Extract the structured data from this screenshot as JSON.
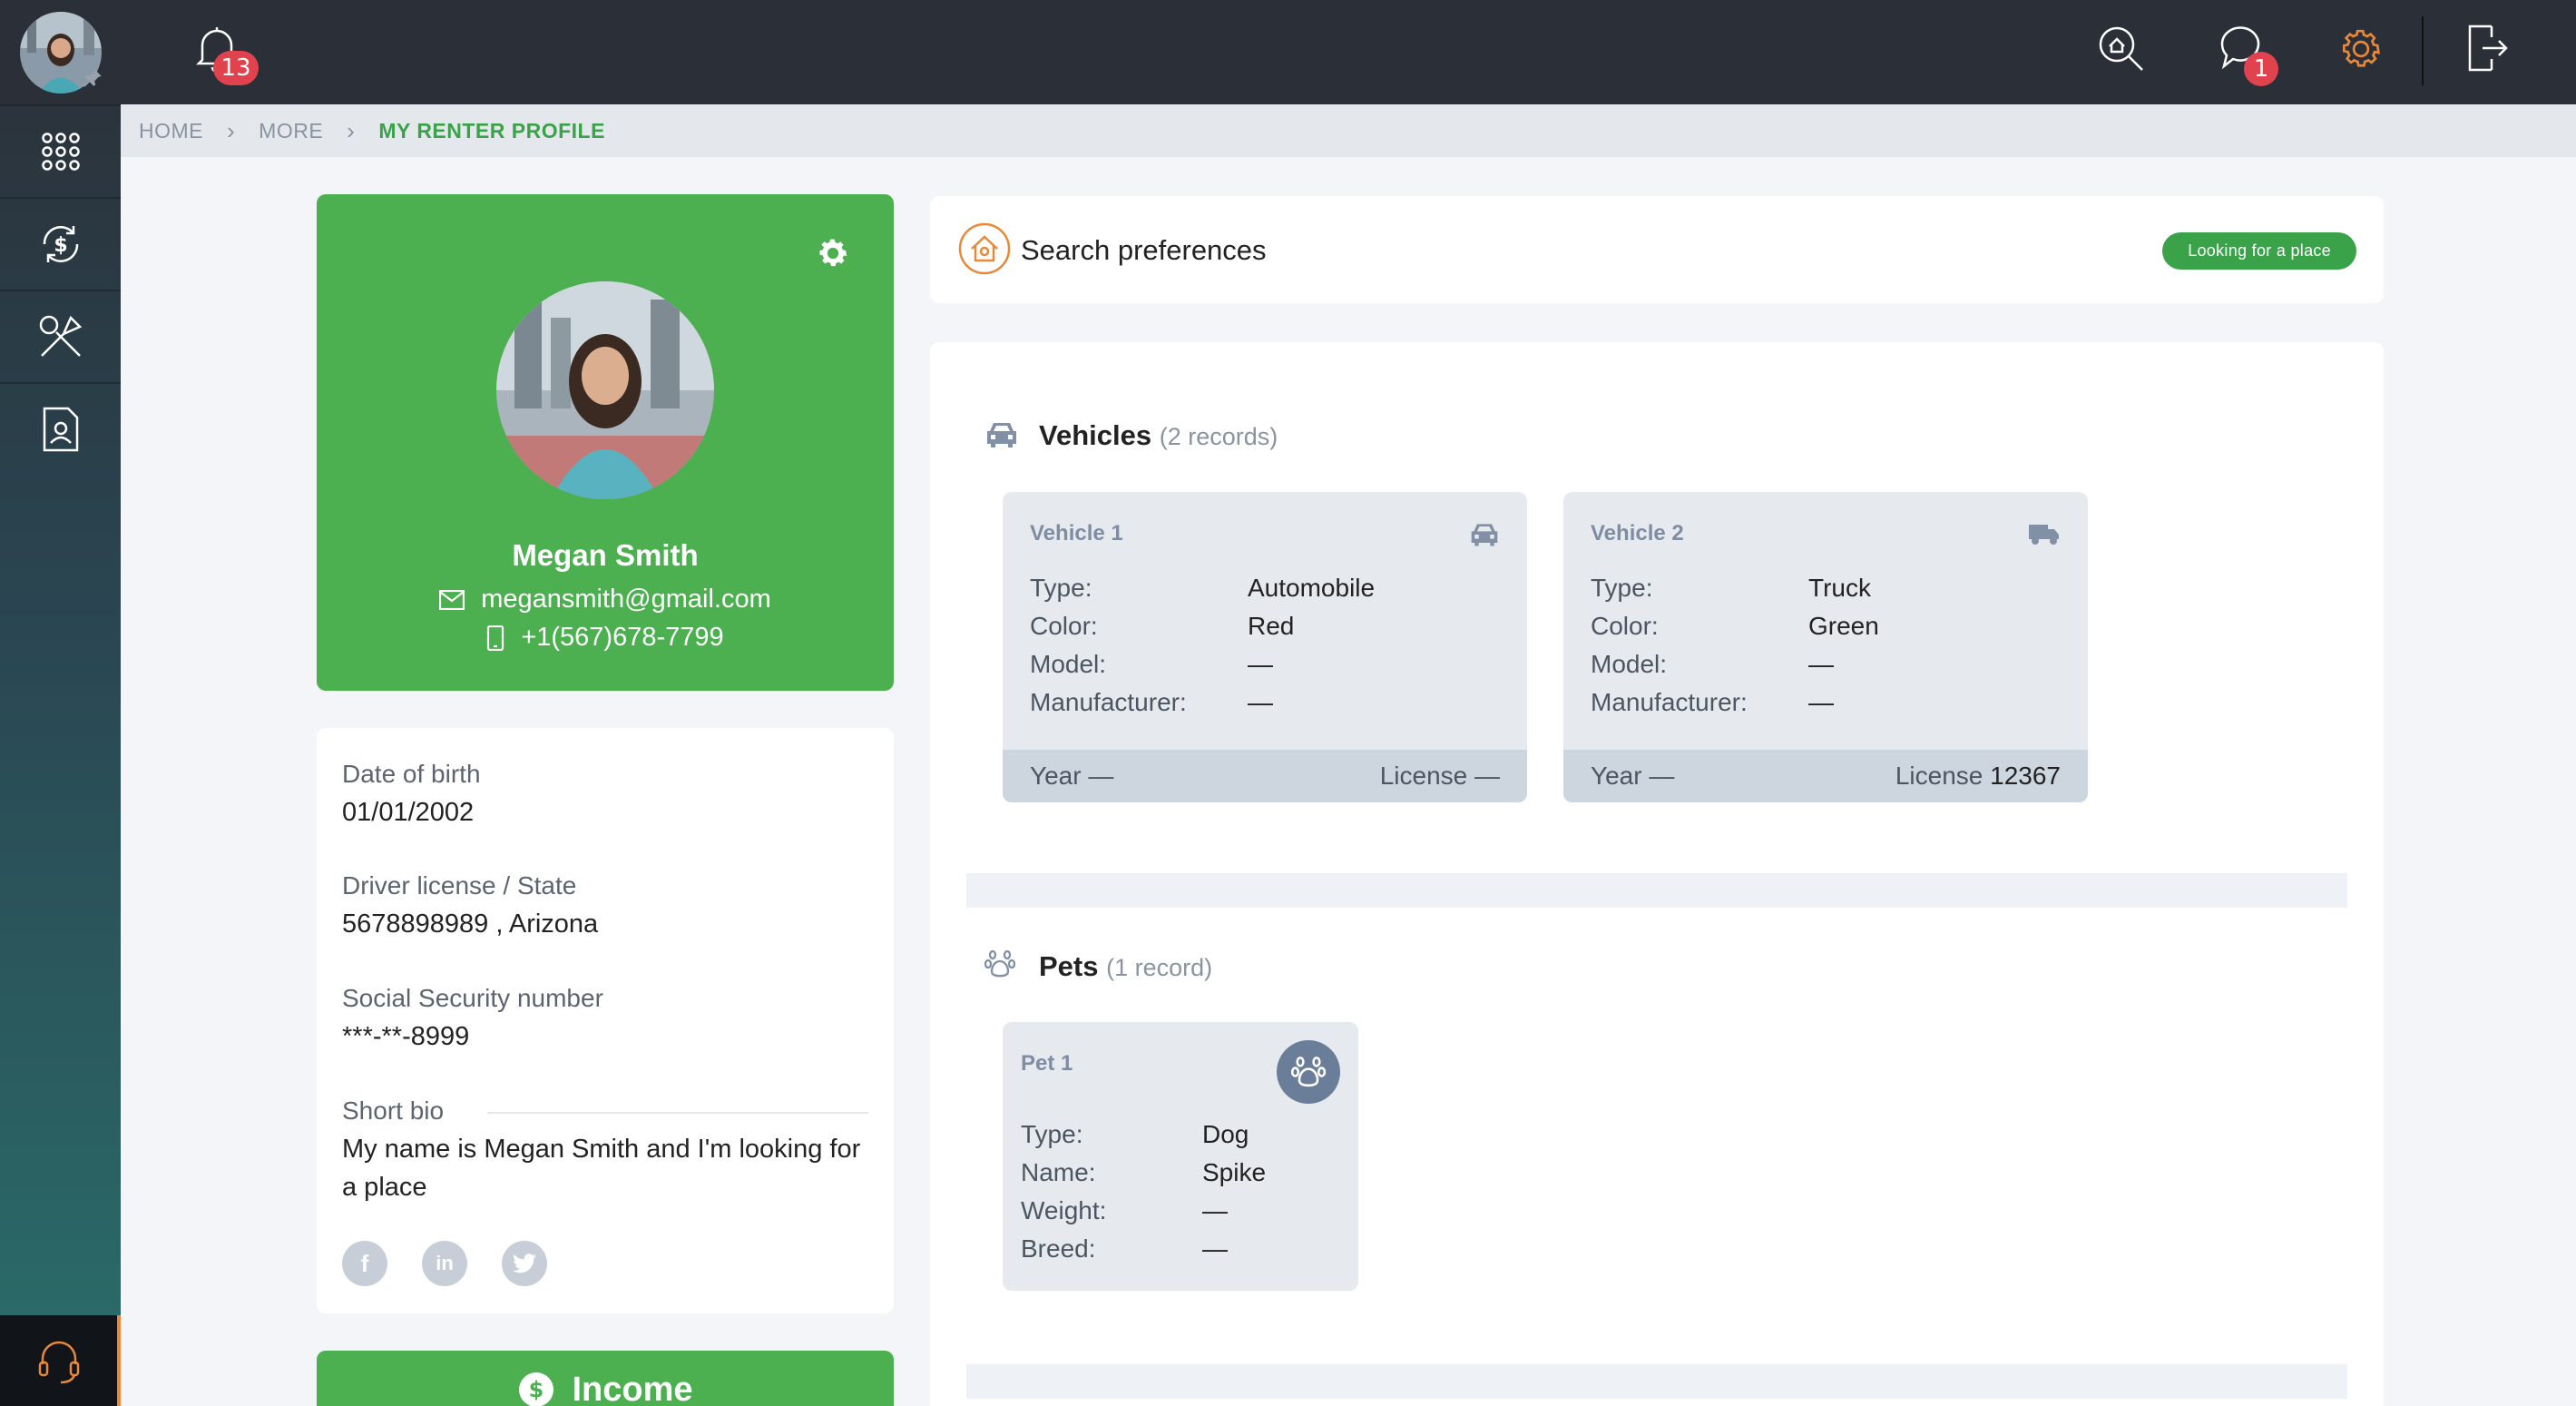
{
  "topbar": {
    "notification_count": "13",
    "message_count": "1"
  },
  "breadcrumb": [
    "HOME",
    "MORE",
    "MY RENTER PROFILE"
  ],
  "profile": {
    "name": "Megan Smith",
    "email": "megansmith@gmail.com",
    "phone": "+1(567)678-7799"
  },
  "details": {
    "dob_label": "Date of birth",
    "dob": "01/01/2002",
    "license_label": "Driver license / State",
    "license": "5678898989 , Arizona",
    "ssn_label": "Social Security number",
    "ssn": "***-**-8999",
    "bio_label": "Short bio",
    "bio_1": "My name is Megan Smith and I'm looking for",
    "bio_2": "a place"
  },
  "income": {
    "label": "Income"
  },
  "prefs": {
    "title": "Search preferences",
    "status": "Looking for a place"
  },
  "vehicles": {
    "title": "Vehicles",
    "count": "(2 records)",
    "labels": {
      "type": "Type:",
      "color": "Color:",
      "model": "Model:",
      "manufacturer": "Manufacturer:",
      "year": "Year",
      "license": "License"
    },
    "items": [
      {
        "title": "Vehicle 1",
        "type": "Automobile",
        "color": "Red",
        "model": "—",
        "manufacturer": "—",
        "year": "—",
        "license": "—"
      },
      {
        "title": "Vehicle 2",
        "type": "Truck",
        "color": "Green",
        "model": "—",
        "manufacturer": "—",
        "year": "—",
        "license": "12367"
      }
    ]
  },
  "pets": {
    "title": "Pets",
    "count": "(1 record)",
    "labels": {
      "type": "Type:",
      "name": "Name:",
      "weight": "Weight:",
      "breed": "Breed:"
    },
    "items": [
      {
        "title": "Pet 1",
        "type": "Dog",
        "name": "Spike",
        "weight": "—",
        "breed": "—"
      }
    ]
  },
  "colors": {
    "green": "#4caf50",
    "accent_orange": "#e8893a",
    "badge_red": "#e0424e",
    "dark": "#2b3038"
  }
}
